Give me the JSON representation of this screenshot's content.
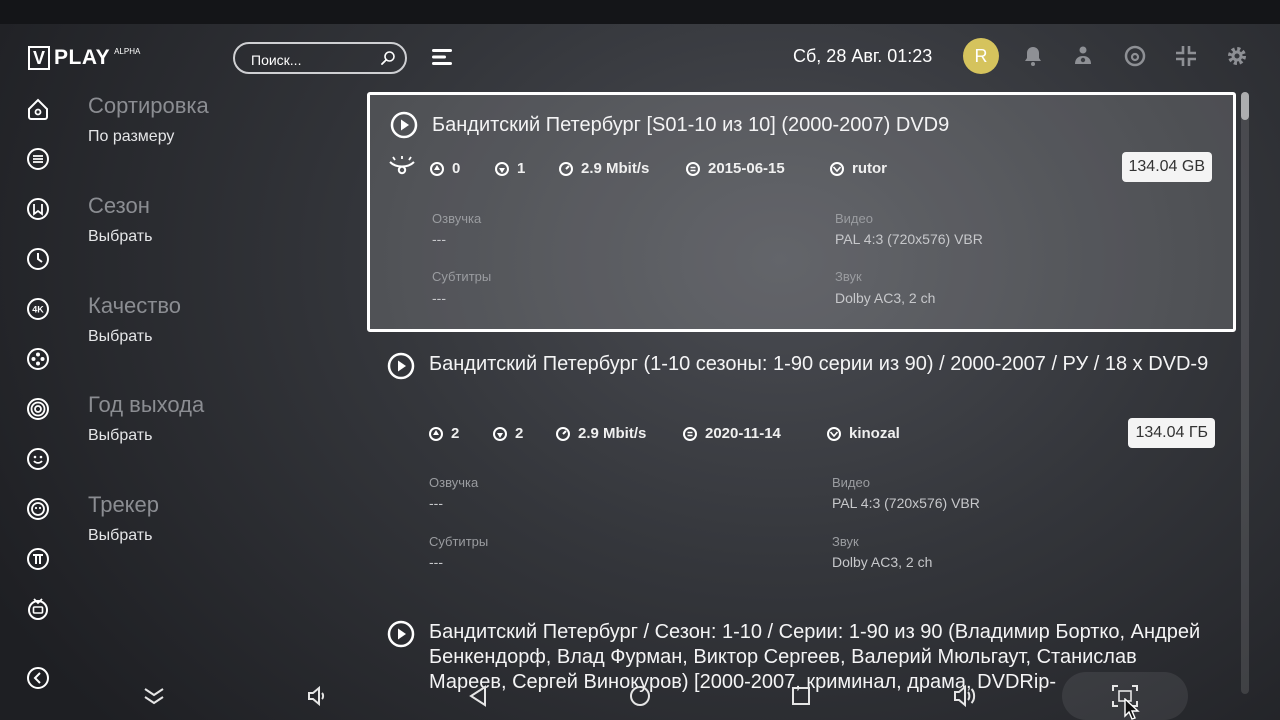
{
  "app": {
    "logo_letter": "V",
    "logo_text": "PLAY",
    "logo_badge": "ALPHA"
  },
  "header": {
    "search_placeholder": "Поиск...",
    "datetime": "Сб, 28 Авг.  01:23",
    "avatar_letter": "R",
    "icons": [
      "menu-icon",
      "bell-icon",
      "child-icon",
      "broadcast-icon",
      "collapse-icon",
      "gear-icon"
    ]
  },
  "sidebar": {
    "icons": [
      "home-icon",
      "list-icon",
      "bookmark-icon",
      "clock-icon",
      "4k-icon",
      "film-icon",
      "target-icon",
      "smile-icon",
      "anime-icon",
      "pi-icon",
      "tv-icon",
      "back-icon"
    ]
  },
  "filters": [
    {
      "title": "Сортировка",
      "value": "По размеру"
    },
    {
      "title": "Сезон",
      "value": "Выбрать"
    },
    {
      "title": "Качество",
      "value": "Выбрать"
    },
    {
      "title": "Год выхода",
      "value": "Выбрать"
    },
    {
      "title": "Трекер",
      "value": "Выбрать"
    }
  ],
  "results": [
    {
      "title": "Бандитский Петербург [S01-10 из 10] (2000-2007) DVD9",
      "seeds": "0",
      "peers": "1",
      "bitrate": "2.9 Mbit/s",
      "date": "2015-06-15",
      "tracker": "rutor",
      "size": "134.04 GB",
      "voice_label": "Озвучка",
      "voice": "---",
      "video_label": "Видео",
      "video": "PAL 4:3 (720x576) VBR",
      "subs_label": "Субтитры",
      "subs": "---",
      "audio_label": "Звук",
      "audio": "Dolby AC3, 2 ch"
    },
    {
      "title": "Бандитский Петербург (1-10 сезоны: 1-90 серии из 90) / 2000-2007 / РУ / 18 x DVD-9",
      "seeds": "2",
      "peers": "2",
      "bitrate": "2.9 Mbit/s",
      "date": "2020-11-14",
      "tracker": "kinozal",
      "size": "134.04 ГБ",
      "voice_label": "Озвучка",
      "voice": "---",
      "video_label": "Видео",
      "video": "PAL 4:3 (720x576) VBR",
      "subs_label": "Субтитры",
      "subs": "---",
      "audio_label": "Звук",
      "audio": "Dolby AC3, 2 ch"
    },
    {
      "title": "Бандитский Петербург / Сезон: 1-10 / Серии: 1-90 из 90 (Владимир Бортко, Андрей Бенкендорф, Влад Фурман, Виктор Сергеев, Валерий Мюльгаут, Станислав Мареев, Сергей Винокуров) [2000-2007, криминал, драма, DVDRip-"
    }
  ],
  "navbar": {
    "icons": [
      "chevron-down-icon",
      "volume-down-icon",
      "nav-back-icon",
      "nav-home-icon",
      "nav-recents-icon",
      "volume-up-icon",
      "screenshot-icon"
    ]
  },
  "colors": {
    "accent": "#d5c35d",
    "selected_border": "#ffffff"
  }
}
